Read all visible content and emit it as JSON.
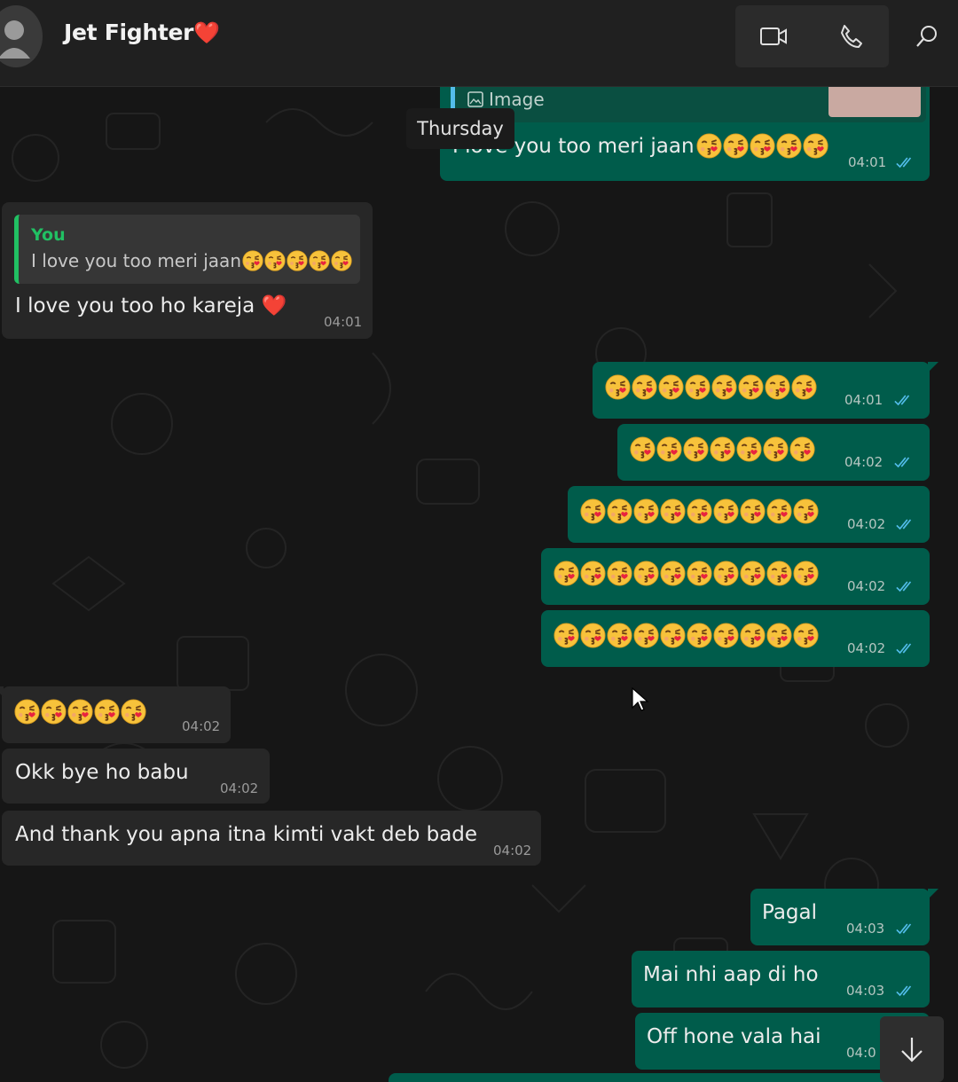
{
  "header": {
    "contact_name": "Jet Fighter",
    "name_emoji": "❤️",
    "icons": [
      "avatar-placeholder",
      "video-call-icon",
      "voice-call-icon",
      "search-icon"
    ]
  },
  "chat": {
    "date_separator": "Thursday",
    "reply_preview_label": "Image",
    "reply_quote_author": "You",
    "reply_quote_text": "I love you too meri jaan",
    "messages": [
      {
        "dir": "out",
        "text": "I love you too meri jaan",
        "emoji_count": 5,
        "time": "04:01",
        "ticks": "read"
      },
      {
        "dir": "in",
        "text": "I love you too ho kareja",
        "emoji": "❤️",
        "time": "04:01"
      },
      {
        "dir": "out",
        "emoji_count": 8,
        "time": "04:01",
        "ticks": "read"
      },
      {
        "dir": "out",
        "emoji_count": 7,
        "time": "04:02",
        "ticks": "read"
      },
      {
        "dir": "out",
        "emoji_count": 9,
        "time": "04:02",
        "ticks": "read"
      },
      {
        "dir": "out",
        "emoji_count": 10,
        "time": "04:02",
        "ticks": "read"
      },
      {
        "dir": "out",
        "emoji_count": 10,
        "time": "04:02",
        "ticks": "read"
      },
      {
        "dir": "in",
        "emoji_count": 5,
        "time": "04:02"
      },
      {
        "dir": "in",
        "text": "Okk bye ho babu",
        "time": "04:02"
      },
      {
        "dir": "in",
        "text": "And thank you apna itna kimti vakt deb bade",
        "time": "04:02"
      },
      {
        "dir": "out",
        "text": "Pagal",
        "time": "04:03",
        "ticks": "read"
      },
      {
        "dir": "out",
        "text": "Mai nhi aap di ho",
        "time": "04:03",
        "ticks": "read"
      },
      {
        "dir": "out",
        "text": "Off hone vala hai",
        "time": "04:0",
        "ticks": "read"
      }
    ]
  },
  "colors": {
    "outgoing_bubble": "#005c4b",
    "incoming_bubble": "#272727",
    "read_ticks": "#53bdeb",
    "quote_accent": "#21c063"
  },
  "scroll_down_icon": "arrow-down-icon",
  "emoji_icon": "face-blowing-kiss-icon"
}
